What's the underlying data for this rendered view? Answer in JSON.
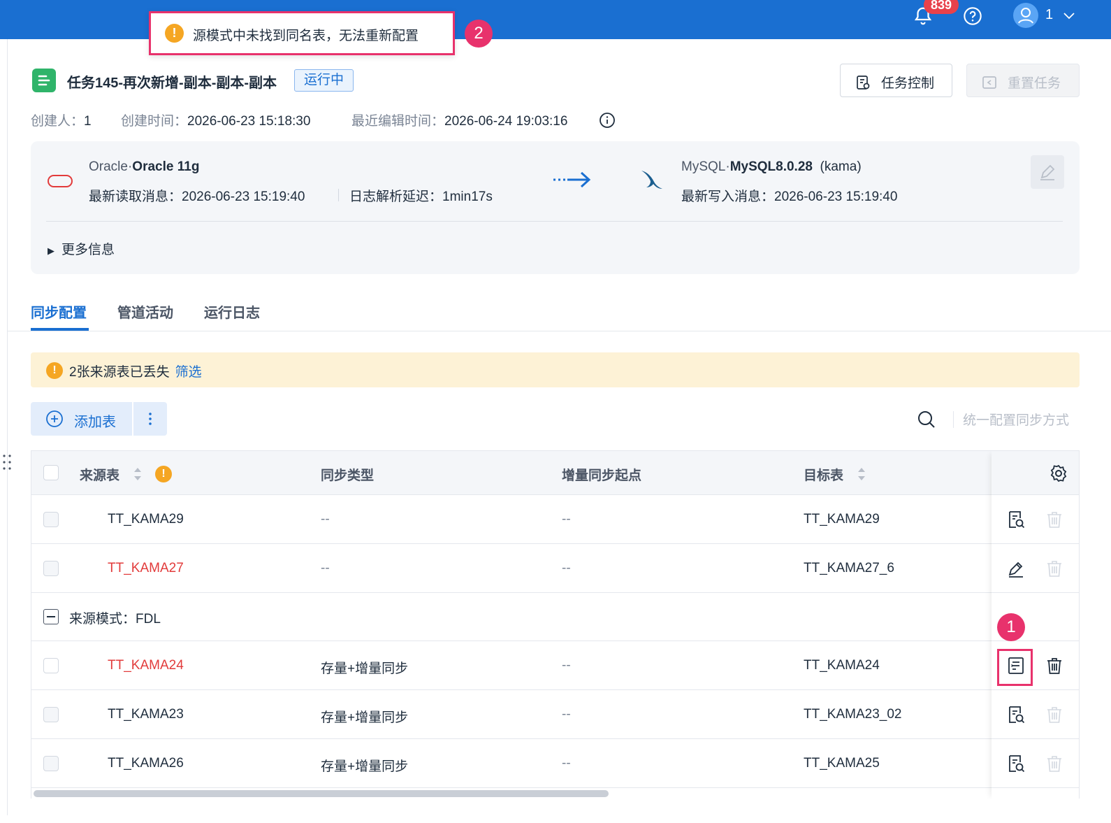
{
  "topbar": {
    "notification_count": "839",
    "user_name": "1",
    "icons": [
      "bell-icon",
      "help-icon",
      "user-avatar-icon",
      "chevron-down-icon"
    ]
  },
  "toast": {
    "message": "源模式中未找到同名表，无法重新配置",
    "marker": "2"
  },
  "task": {
    "title": "任务145-再次新增-副本-副本-副本",
    "status": "运行中",
    "control_label": "任务控制",
    "reset_label": "重置任务"
  },
  "meta": {
    "creator_label": "创建人：",
    "creator": "1",
    "created_label": "创建时间：",
    "created": "2026-06-23 15:18:30",
    "edited_label": "最近编辑时间：",
    "edited": "2026-06-24 19:03:16"
  },
  "source": {
    "type": "Oracle",
    "sep": "·",
    "name": "Oracle 11g",
    "read_label": "最新读取消息：",
    "read_time": "2026-06-23 15:19:40",
    "delay_label": "日志解析延迟：",
    "delay": "1min17s"
  },
  "target": {
    "type": "MySQL",
    "sep": "·",
    "name": "MySQL8.0.28",
    "schema": "(kama)",
    "write_label": "最新写入消息：",
    "write_time": "2026-06-23 15:19:40"
  },
  "more_info": "更多信息",
  "tabs": [
    {
      "label": "同步配置",
      "active": true
    },
    {
      "label": "管道活动",
      "active": false
    },
    {
      "label": "运行日志",
      "active": false
    }
  ],
  "warning": {
    "text": "2张来源表已丢失",
    "link": "筛选"
  },
  "toolbar": {
    "add_label": "添加表",
    "unify_label": "统一配置同步方式"
  },
  "table": {
    "columns": [
      "来源表",
      "同步类型",
      "增量同步起点",
      "目标表"
    ],
    "rows": [
      {
        "source": "TT_KAMA29",
        "sync_type": "--",
        "start": "--",
        "target": "TT_KAMA29",
        "lost": false,
        "action": "preview"
      },
      {
        "source": "TT_KAMA27",
        "sync_type": "--",
        "start": "--",
        "target": "TT_KAMA27_6",
        "lost": true,
        "action": "edit"
      }
    ],
    "group_label": "来源模式：FDL",
    "group_rows": [
      {
        "source": "TT_KAMA24",
        "sync_type": "存量+增量同步",
        "start": "--",
        "target": "TT_KAMA24",
        "lost": true,
        "action": "reconfig"
      },
      {
        "source": "TT_KAMA23",
        "sync_type": "存量+增量同步",
        "start": "--",
        "target": "TT_KAMA23_02",
        "lost": false,
        "action": "preview"
      },
      {
        "source": "TT_KAMA26",
        "sync_type": "存量+增量同步",
        "start": "--",
        "target": "TT_KAMA25",
        "lost": false,
        "action": "preview"
      }
    ],
    "action_marker": "1"
  },
  "colors": {
    "brand": "#1a6fd1",
    "lost": "#e23b3b",
    "warning": "#f5a623",
    "highlight": "#e8326c"
  }
}
